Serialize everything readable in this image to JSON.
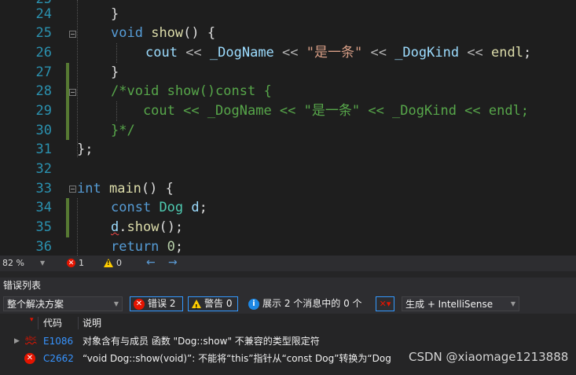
{
  "editor": {
    "line_numbers": [
      "25",
      "24",
      "25",
      "26",
      "27",
      "28",
      "29",
      "30",
      "31",
      "32",
      "33",
      "34",
      "35",
      "36"
    ],
    "lines": {
      "l24": "}",
      "l25_kw": "void",
      "l25_fn": "show",
      "l25_rest": "() {",
      "l26_cout": "cout",
      "l26_op1": " << ",
      "l26_var1": "_DogName",
      "l26_op2": " << ",
      "l26_str": "\"是一条\"",
      "l26_op3": " << ",
      "l26_var2": "_DogKind",
      "l26_op4": " << ",
      "l26_endl": "endl",
      "l26_end": ";",
      "l27": "}",
      "l28": "/*void show()const {",
      "l29": "    cout << _DogName << \"是一条\" << _DogKind << endl;",
      "l30": "}*/",
      "l31": "};",
      "l33_kw": "int",
      "l33_fn": "main",
      "l33_rest": "() {",
      "l34_kw": "const",
      "l34_ty": "Dog",
      "l34_var": "d",
      "l34_end": ";",
      "l35_var": "d",
      "l35_dot": ".",
      "l35_fn": "show",
      "l35_rest": "();",
      "l36_kw": "return",
      "l36_num": "0",
      "l36_end": ";"
    }
  },
  "status": {
    "zoom": "82 %",
    "errors": "1",
    "warnings": "0",
    "back_arrow": "←",
    "fwd_arrow": "→"
  },
  "panel": {
    "title": "错误列表",
    "scope": "整个解决方案",
    "errors_btn": "错误 2",
    "warnings_btn": "警告 0",
    "messages_btn": "展示 2 个消息中的 0 个",
    "source": "生成 + IntelliSense",
    "col_code": "代码",
    "col_desc": "说明",
    "rows": [
      {
        "code": "E1086",
        "desc": "对象含有与成员 函数 \"Dog::show\" 不兼容的类型限定符"
      },
      {
        "code": "C2662",
        "desc": "“void Dog::show(void)”: 不能将“this”指针从“const Dog”转换为“Dog &”"
      }
    ]
  },
  "watermark": "CSDN @xiaomage1213888",
  "colors": {
    "keyword": "#569cd6",
    "function": "#dcdcaa",
    "type": "#4ec9b0",
    "string": "#d69d85",
    "comment": "#57a64a",
    "error": "#e51400"
  }
}
